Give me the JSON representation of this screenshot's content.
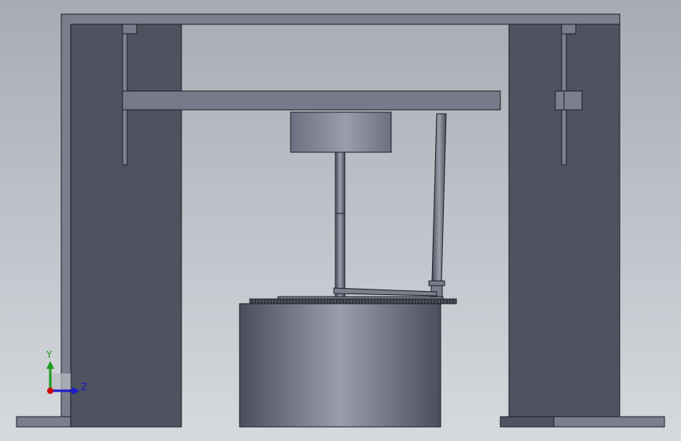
{
  "colors": {
    "bg_top": "#a7acb4",
    "bg_bottom": "#d6d9de",
    "frame_fill": "#7b7f8d",
    "frame_dark": "#4f525f",
    "edge": "#1c1e24",
    "beam_fill": "#777b89",
    "hub_fill": "#6c7080",
    "drum_light": "#9a9eab",
    "drum_dark": "#4b4e5b",
    "axis_x": "#cc0000",
    "axis_y": "#1a9a1a",
    "axis_z": "#1a1acc"
  },
  "view_triad": {
    "y_label": "Y",
    "z_label": "Z"
  }
}
